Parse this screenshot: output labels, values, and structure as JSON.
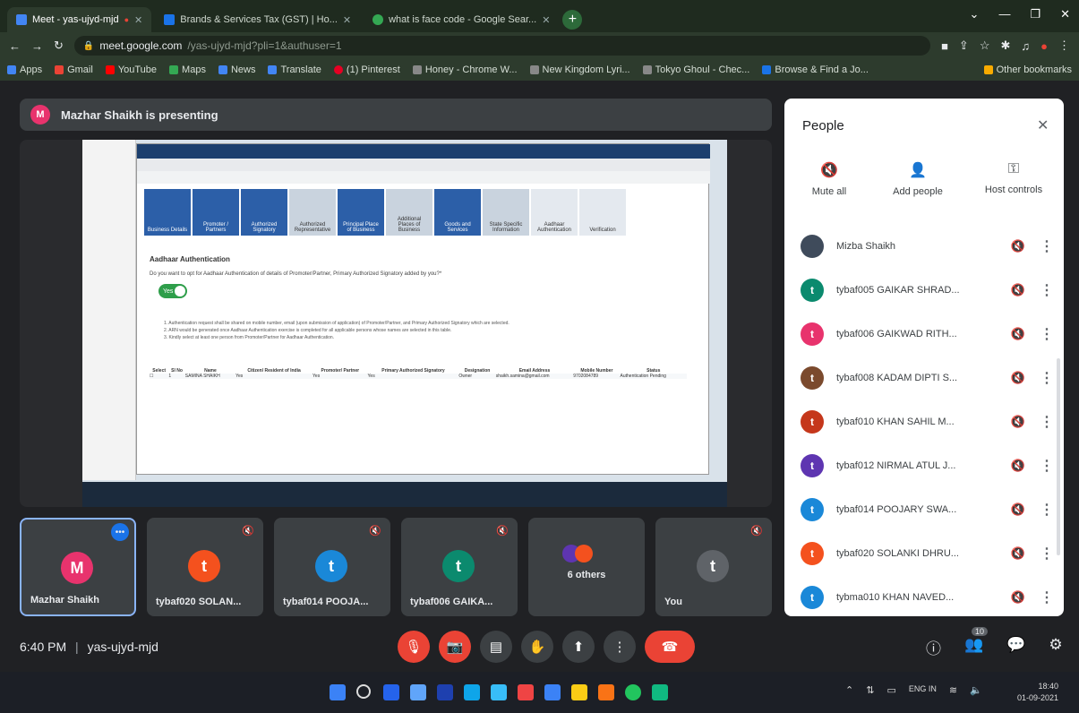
{
  "browser": {
    "tabs": [
      {
        "label": "Meet - yas-ujyd-mjd",
        "color": "#4285f4",
        "active": true
      },
      {
        "label": "Brands & Services Tax (GST) | Ho...",
        "color": "#1a73e8",
        "active": false
      },
      {
        "label": "what is face code - Google Sear...",
        "color": "#34a853",
        "active": false
      }
    ],
    "new_tab": "+",
    "window_buttons": [
      "⌄",
      "—",
      "❐",
      "✕"
    ],
    "url_host": "meet.google.com",
    "url_path": "/yas-ujyd-mjd?pli=1&authuser=1",
    "bookmarks": [
      {
        "label": "Apps",
        "color": "#4285f4"
      },
      {
        "label": "Gmail",
        "color": "#ea4335"
      },
      {
        "label": "YouTube",
        "color": "#ff0000"
      },
      {
        "label": "Maps",
        "color": "#34a853"
      },
      {
        "label": "News",
        "color": "#4285f4"
      },
      {
        "label": "Translate",
        "color": "#4285f4"
      },
      {
        "label": "(1) Pinterest",
        "color": "#e60023"
      },
      {
        "label": "Honey - Chrome W...",
        "color": "#888888"
      },
      {
        "label": "New Kingdom Lyri...",
        "color": "#888888"
      },
      {
        "label": "Tokyo Ghoul - Chec...",
        "color": "#888888"
      },
      {
        "label": "Browse & Find a Jo...",
        "color": "#1a73e8"
      },
      {
        "label": "Other bookmarks",
        "color": "#f9ab00"
      }
    ]
  },
  "meet": {
    "presenting_text": "Mazhar Shaikh is presenting",
    "presenter_initial": "M",
    "shared_screen": {
      "section_title": "Aadhaar Authentication",
      "question": "Do you want to opt for Aadhaar Authentication of details of Promoter/Partner, Primary Authorized Signatory added by you?*",
      "toggle_label": "Yes",
      "notes": [
        "1. Authentication request shall be shared on mobile number, email (upon submission of application) of Promoter/Partner, and Primary Authorized Signatory which are selected.",
        "2. ARN would be generated once Aadhaar Authentication exercise is completed for all applicable persons whose names are selected in this table.",
        "3. Kindly select at least one person from Promoter/Partner for Aadhaar Authentication."
      ],
      "table_headers": [
        "Select",
        "Sl No",
        "Name",
        "Citizen/ Resident of India",
        "Promoter/ Partner",
        "Primary Authorized Signatory",
        "Designation",
        "Email Address",
        "Mobile Number",
        "Status"
      ],
      "table_row": [
        "",
        "1",
        "SAMINA SHAIKH",
        "Yes",
        "Yes",
        "Yes",
        "Owner",
        "shaikh.samina@gmail.com",
        "9702084789",
        "Authentication Pending"
      ],
      "step_tiles": [
        "Business Details",
        "Promoter / Partners",
        "Authorized Signatory",
        "Authorized Representative",
        "Principal Place of Business",
        "Additional Places of Business",
        "Goods and Services",
        "State Specific Information",
        "Aadhaar Authentication",
        "Verification"
      ]
    },
    "tiles": [
      {
        "name": "Mazhar Shaikh",
        "initial": "M",
        "color": "#e8336d",
        "active": true
      },
      {
        "name": "tybaf020 SOLAN...",
        "initial": "t",
        "color": "#f4511e"
      },
      {
        "name": "tybaf014 POOJA...",
        "initial": "t",
        "color": "#1a88d8"
      },
      {
        "name": "tybaf006 GAIKA...",
        "initial": "t",
        "color": "#0b8a6e"
      },
      {
        "name": "6 others",
        "initial": "",
        "color": "#3c4043"
      },
      {
        "name": "You",
        "initial": "t",
        "color": "#5f6368"
      }
    ],
    "time": "6:40 PM",
    "meeting_code": "yas-ujyd-mjd",
    "controls": {
      "mic": "🎙",
      "camera": "📷",
      "captions": "▤",
      "raise_hand": "✋",
      "present": "⬆",
      "more": "⋮",
      "end_call": "☎"
    },
    "right_icons": [
      "ⓘ",
      "👥",
      "💬",
      "⚙"
    ],
    "participant_count": "10"
  },
  "people_panel": {
    "title": "People",
    "close": "✕",
    "actions": [
      "Mute all",
      "Add people",
      "Host controls"
    ],
    "participants": [
      {
        "name": "Mizba Shaikh",
        "initial": "",
        "color": "#5f6368"
      },
      {
        "name": "tybaf005 GAIKAR SHRAD...",
        "initial": "t",
        "color": "#0b8a6e"
      },
      {
        "name": "tybaf006 GAIKWAD RITH...",
        "initial": "t",
        "color": "#e8336d"
      },
      {
        "name": "tybaf008 KADAM DIPTI S...",
        "initial": "t",
        "color": "#7b4a2d"
      },
      {
        "name": "tybaf010 KHAN SAHIL M...",
        "initial": "t",
        "color": "#c5371b"
      },
      {
        "name": "tybaf012 NIRMAL ATUL J...",
        "initial": "t",
        "color": "#5e35b1"
      },
      {
        "name": "tybaf014 POOJARY SWA...",
        "initial": "t",
        "color": "#1a88d8"
      },
      {
        "name": "tybaf020 SOLANKI DHRU...",
        "initial": "t",
        "color": "#f4511e"
      },
      {
        "name": "tybma010 KHAN NAVED...",
        "initial": "t",
        "color": "#1a88d8"
      }
    ]
  },
  "taskbar": {
    "tray_lang": "ENG IN",
    "clock_time": "18:40",
    "clock_date": "01-09-2021"
  }
}
